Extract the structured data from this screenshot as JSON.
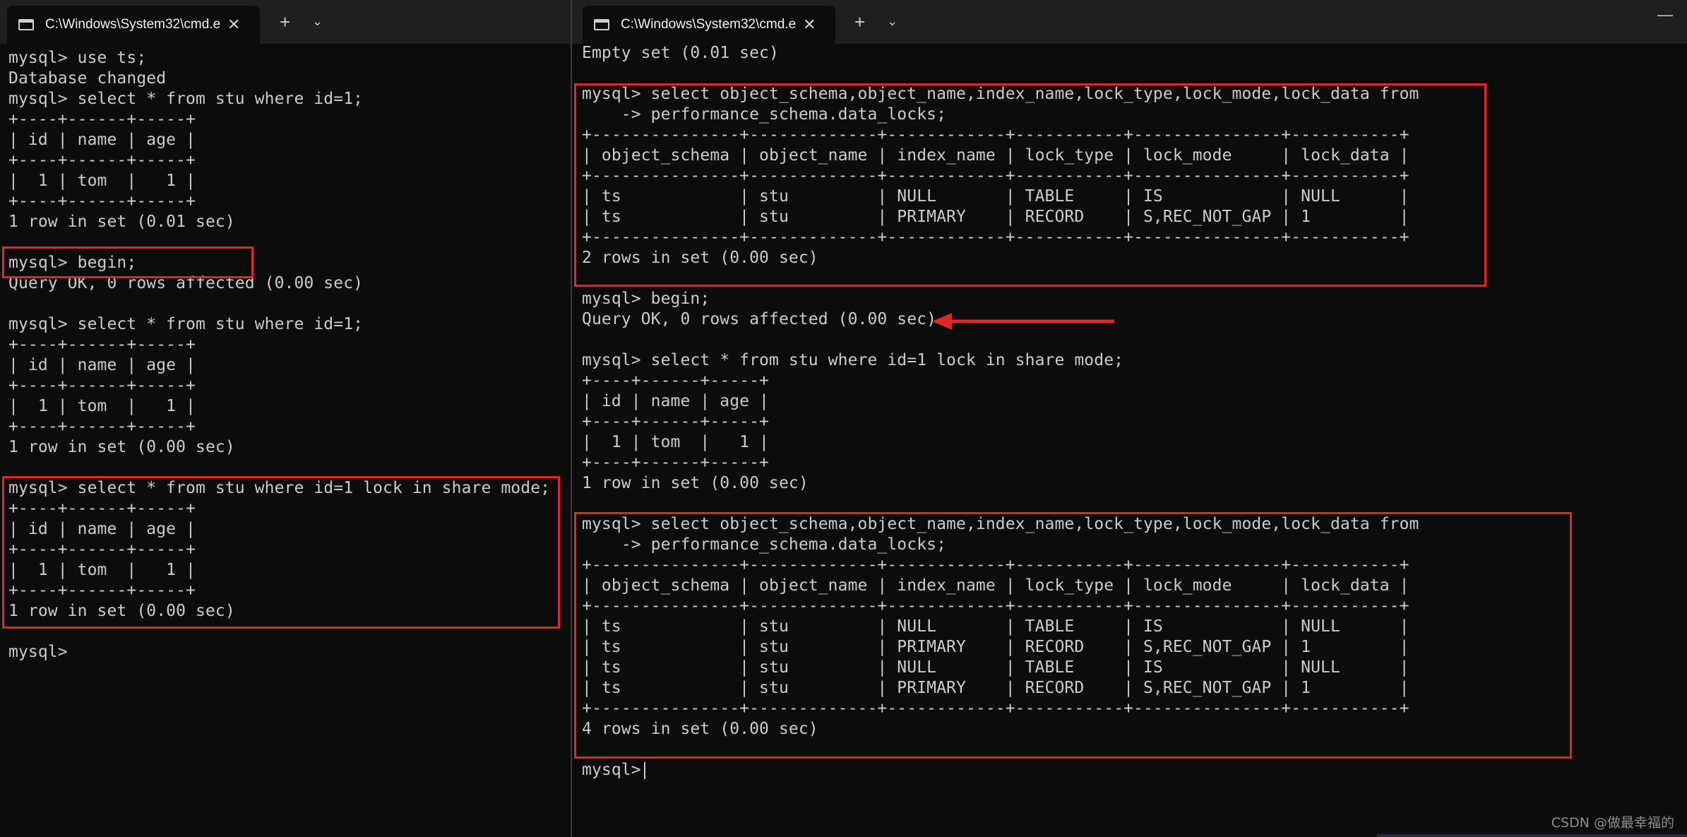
{
  "left_window": {
    "tab_title": "C:\\Windows\\System32\\cmd.e",
    "close_glyph": "✕",
    "new_tab_glyph": "+",
    "dropdown_glyph": "⌄",
    "lines": [
      "mysql> use ts;",
      "Database changed",
      "mysql> select * from stu where id=1;",
      "+----+------+-----+",
      "| id | name | age |",
      "+----+------+-----+",
      "|  1 | tom  |   1 |",
      "+----+------+-----+",
      "1 row in set (0.01 sec)",
      "",
      "mysql> begin;",
      "Query OK, 0 rows affected (0.00 sec)",
      "",
      "mysql> select * from stu where id=1;",
      "+----+------+-----+",
      "| id | name | age |",
      "+----+------+-----+",
      "|  1 | tom  |   1 |",
      "+----+------+-----+",
      "1 row in set (0.00 sec)",
      "",
      "mysql> select * from stu where id=1 lock in share mode;",
      "+----+------+-----+",
      "| id | name | age |",
      "+----+------+-----+",
      "|  1 | tom  |   1 |",
      "+----+------+-----+",
      "1 row in set (0.00 sec)",
      "",
      "mysql>"
    ]
  },
  "right_window": {
    "tab_title": "C:\\Windows\\System32\\cmd.e",
    "close_glyph": "✕",
    "new_tab_glyph": "+",
    "dropdown_glyph": "⌄",
    "window_controls": "—",
    "lines": [
      "Empty set (0.01 sec)",
      "",
      "mysql> select object_schema,object_name,index_name,lock_type,lock_mode,lock_data from",
      "    -> performance_schema.data_locks;",
      "+---------------+-------------+------------+-----------+---------------+-----------+",
      "| object_schema | object_name | index_name | lock_type | lock_mode     | lock_data |",
      "+---------------+-------------+------------+-----------+---------------+-----------+",
      "| ts            | stu         | NULL       | TABLE     | IS            | NULL      |",
      "| ts            | stu         | PRIMARY    | RECORD    | S,REC_NOT_GAP | 1         |",
      "+---------------+-------------+------------+-----------+---------------+-----------+",
      "2 rows in set (0.00 sec)",
      "",
      "mysql> begin;",
      "Query OK, 0 rows affected (0.00 sec)",
      "",
      "mysql> select * from stu where id=1 lock in share mode;",
      "+----+------+-----+",
      "| id | name | age |",
      "+----+------+-----+",
      "|  1 | tom  |   1 |",
      "+----+------+-----+",
      "1 row in set (0.00 sec)",
      "",
      "mysql> select object_schema,object_name,index_name,lock_type,lock_mode,lock_data from",
      "    -> performance_schema.data_locks;",
      "+---------------+-------------+------------+-----------+---------------+-----------+",
      "| object_schema | object_name | index_name | lock_type | lock_mode     | lock_data |",
      "+---------------+-------------+------------+-----------+---------------+-----------+",
      "| ts            | stu         | NULL       | TABLE     | IS            | NULL      |",
      "| ts            | stu         | PRIMARY    | RECORD    | S,REC_NOT_GAP | 1         |",
      "| ts            | stu         | NULL       | TABLE     | IS            | NULL      |",
      "| ts            | stu         | PRIMARY    | RECORD    | S,REC_NOT_GAP | 1         |",
      "+---------------+-------------+------------+-----------+---------------+-----------+",
      "4 rows in set (0.00 sec)",
      "",
      "mysql>"
    ]
  },
  "watermark": "CSDN @做最幸福的",
  "colors": {
    "highlight": "#e0262b",
    "terminal_bg": "#0c0c0c",
    "terminal_fg": "#cccccc"
  }
}
